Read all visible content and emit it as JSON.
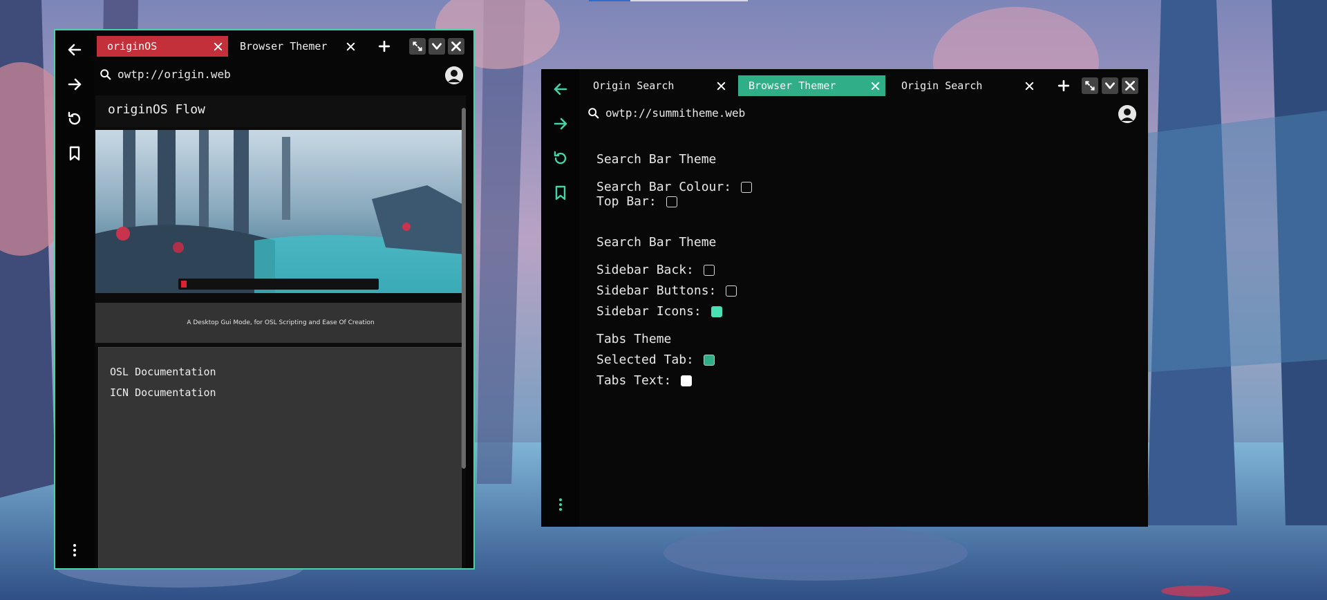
{
  "colors": {
    "accent": "#45d4a8",
    "selected_tab_left": "#c3303a",
    "selected_tab_right": "#2fae87",
    "window_bg": "#070707",
    "panel_gray": "#353535"
  },
  "left_window": {
    "tabs": [
      {
        "label": "originOS",
        "selected": true
      },
      {
        "label": "Browser Themer",
        "selected": false
      }
    ],
    "address": "owtp://origin.web",
    "sidebar_icons": [
      "back-arrow-icon",
      "forward-arrow-icon",
      "refresh-icon",
      "bookmark-icon",
      "more-vertical-icon"
    ],
    "page": {
      "title": "originOS Flow",
      "tagline": "A Desktop Gui Mode, for OSL Scripting and Ease Of Creation",
      "links": [
        "OSL Documentation",
        "ICN Documentation"
      ]
    }
  },
  "right_window": {
    "tabs": [
      {
        "label": "Origin Search",
        "selected": false
      },
      {
        "label": "Browser Themer",
        "selected": true
      },
      {
        "label": "Origin Search",
        "selected": false
      }
    ],
    "address": "owtp://summitheme.web",
    "sections": [
      {
        "heading": "Search Bar Theme",
        "rows": [
          {
            "label": "Search Bar Colour:",
            "swatch": ""
          },
          {
            "label": "Top Bar:",
            "swatch": ""
          }
        ]
      },
      {
        "heading": "Search Bar Theme",
        "rows": [
          {
            "label": "Sidebar Back:",
            "swatch": ""
          },
          {
            "label": "Sidebar Buttons:",
            "swatch": ""
          },
          {
            "label": "Sidebar Icons:",
            "swatch": "#4be0b4"
          }
        ]
      },
      {
        "heading": "Tabs Theme",
        "rows": [
          {
            "label": "Selected Tab:",
            "swatch": "#2fae87"
          },
          {
            "label": "Tabs Text:",
            "swatch": "#ffffff"
          }
        ]
      }
    ]
  }
}
